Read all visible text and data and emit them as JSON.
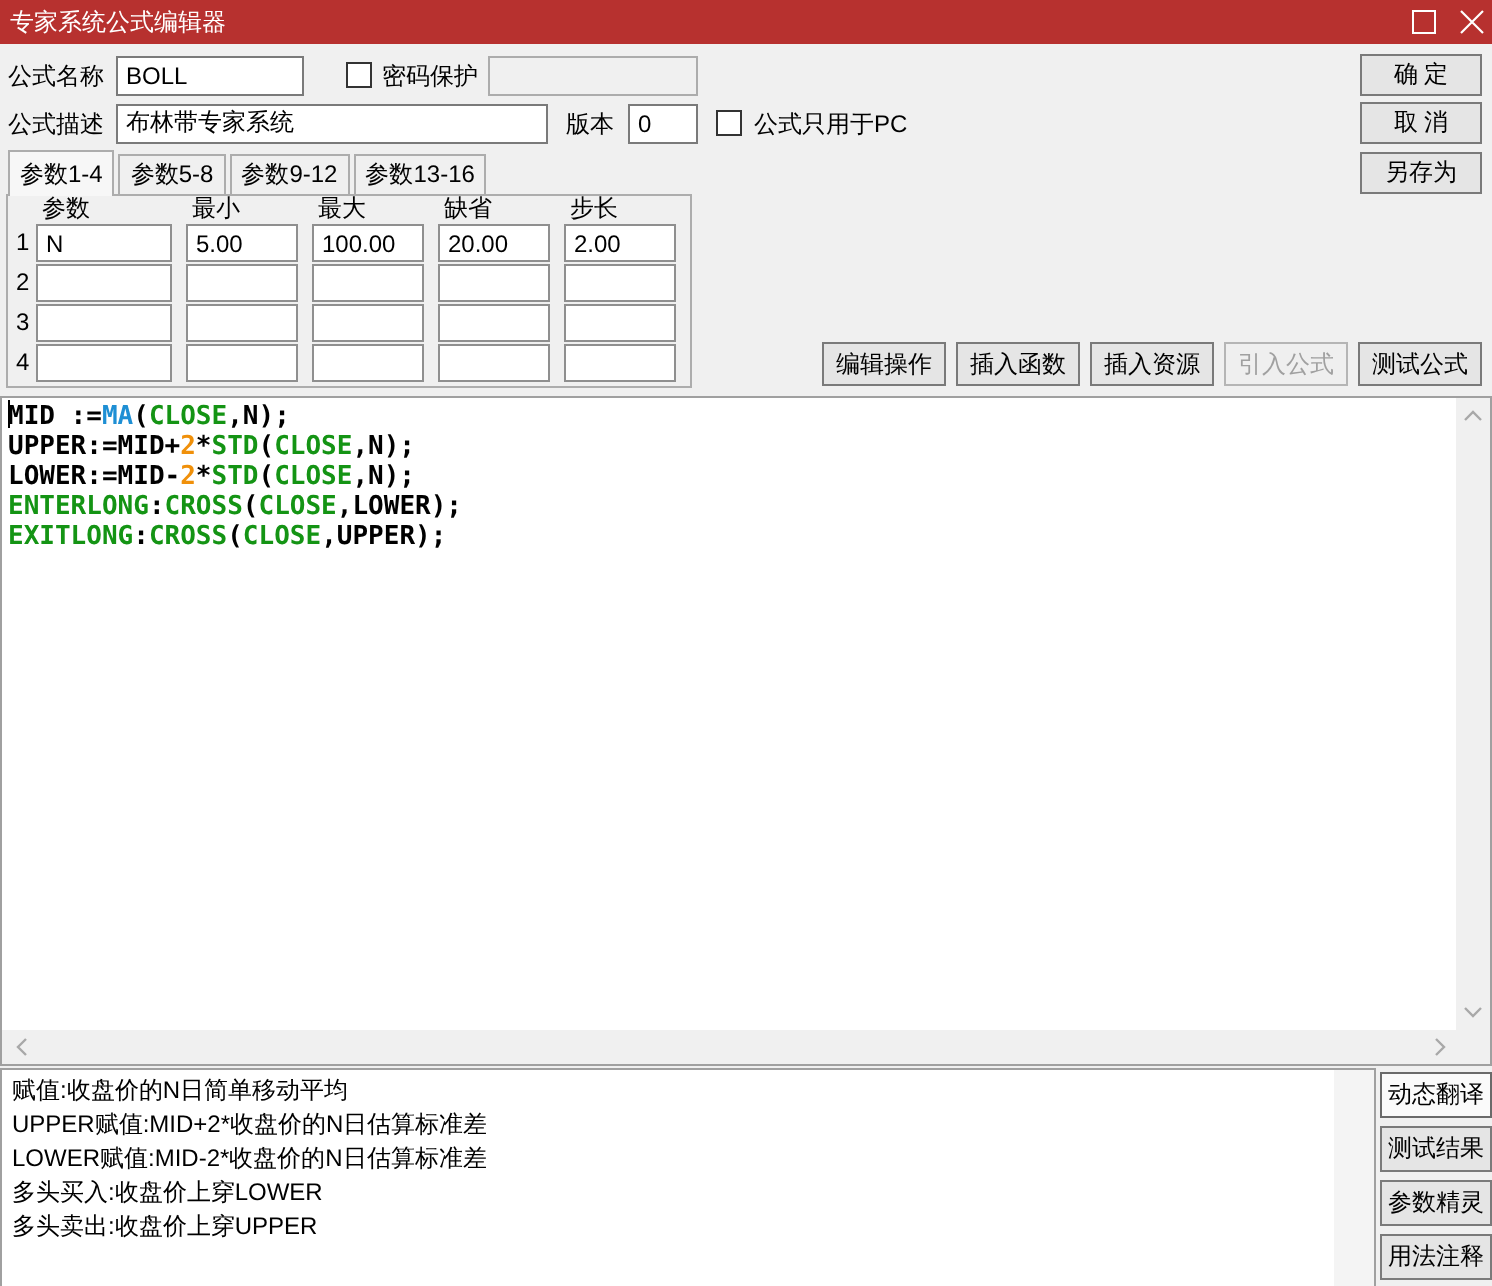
{
  "window": {
    "title": "专家系统公式编辑器"
  },
  "formula": {
    "name_label": "公式名称",
    "name": "BOLL",
    "password": {
      "label": "密码保护",
      "checked": false,
      "field_disabled": true
    },
    "description_label": "公式描述",
    "description": "布林带专家系统",
    "version_label": "版本",
    "version": "0",
    "pc_only": {
      "label": "公式只用于PC",
      "checked": false
    }
  },
  "side_buttons": [
    {
      "label": "确 定"
    },
    {
      "label": "取 消"
    },
    {
      "label": "另存为"
    }
  ],
  "tabs": [
    {
      "label": "参数1-4",
      "selected": true
    },
    {
      "label": "参数5-8",
      "selected": false
    },
    {
      "label": "参数9-12",
      "selected": false
    },
    {
      "label": "参数13-16",
      "selected": false
    }
  ],
  "params": {
    "columns": [
      "参数",
      "最小",
      "最大",
      "缺省",
      "步长"
    ],
    "rows": [
      {
        "number": "1",
        "cells": [
          "N",
          "5.00",
          "100.00",
          "20.00",
          "2.00"
        ]
      },
      {
        "number": "2"
      },
      {
        "number": "3"
      },
      {
        "number": "4"
      }
    ]
  },
  "tool_buttons": [
    {
      "label": "编辑操作",
      "disabled": false
    },
    {
      "label": "插入函数",
      "disabled": false
    },
    {
      "label": "插入资源",
      "disabled": false
    },
    {
      "label": "引入公式",
      "disabled": true
    },
    {
      "label": "测试公式",
      "disabled": false
    }
  ],
  "editor": {
    "lines": [
      {
        "cursor": true,
        "tokens": [
          {
            "text": "MID :="
          },
          {
            "text": "MA",
            "color": "#1e8fd4"
          },
          {
            "text": "("
          },
          {
            "text": "CLOSE",
            "color": "#149414"
          },
          {
            "text": ",N);"
          }
        ]
      },
      {
        "cursor": false,
        "tokens": [
          {
            "text": "UPPER:=MID+"
          },
          {
            "text": "2",
            "color": "#f0900a"
          },
          {
            "text": "*"
          },
          {
            "text": "STD",
            "color": "#149414"
          },
          {
            "text": "("
          },
          {
            "text": "CLOSE",
            "color": "#149414"
          },
          {
            "text": ",N);"
          }
        ]
      },
      {
        "cursor": false,
        "tokens": [
          {
            "text": "LOWER:=MID-"
          },
          {
            "text": "2",
            "color": "#f0900a"
          },
          {
            "text": "*"
          },
          {
            "text": "STD",
            "color": "#149414"
          },
          {
            "text": "("
          },
          {
            "text": "CLOSE",
            "color": "#149414"
          },
          {
            "text": ",N);"
          }
        ]
      },
      {
        "cursor": false,
        "tokens": [
          {
            "text": "ENTERLONG",
            "color": "#149414"
          },
          {
            "text": ":"
          },
          {
            "text": "CROSS",
            "color": "#149414"
          },
          {
            "text": "("
          },
          {
            "text": "CLOSE",
            "color": "#149414"
          },
          {
            "text": ",LOWER);"
          }
        ]
      },
      {
        "cursor": false,
        "tokens": [
          {
            "text": "EXITLONG",
            "color": "#149414"
          },
          {
            "text": ":"
          },
          {
            "text": "CROSS",
            "color": "#149414"
          },
          {
            "text": "("
          },
          {
            "text": "CLOSE",
            "color": "#149414"
          },
          {
            "text": ",UPPER);"
          }
        ]
      }
    ]
  },
  "translation": {
    "lines": [
      "赋值:收盘价的N日简单移动平均",
      "UPPER赋值:MID+2*收盘价的N日估算标准差",
      "LOWER赋值:MID-2*收盘价的N日估算标准差",
      "多头买入:收盘价上穿LOWER",
      "多头卖出:收盘价上穿UPPER"
    ]
  },
  "view_buttons": [
    {
      "label": "动态翻译",
      "selected": true
    },
    {
      "label": "测试结果",
      "selected": false
    },
    {
      "label": "参数精灵",
      "selected": false
    },
    {
      "label": "用法注释",
      "selected": false
    }
  ]
}
